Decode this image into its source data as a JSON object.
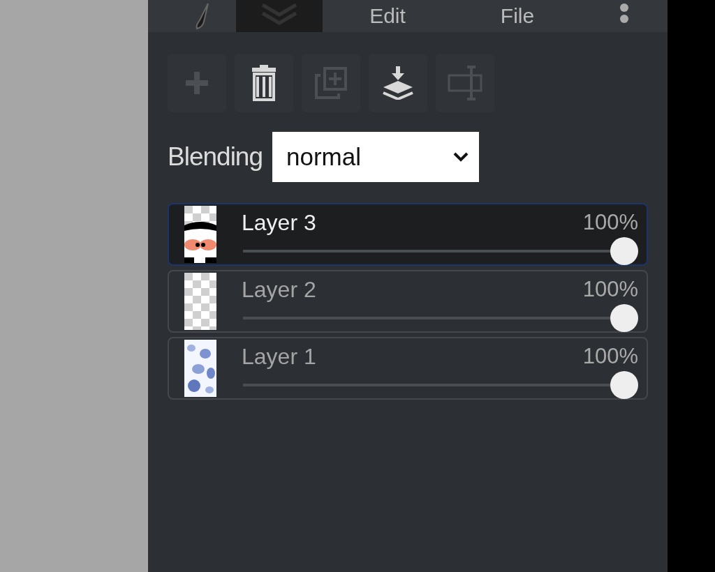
{
  "tabs": [
    {
      "kind": "brush",
      "selected": false
    },
    {
      "kind": "layers",
      "selected": true
    },
    {
      "kind": "text",
      "label": "Edit",
      "selected": false
    },
    {
      "kind": "text",
      "label": "File",
      "selected": false
    },
    {
      "kind": "more",
      "selected": false
    }
  ],
  "toolbar": [
    {
      "kind": "add",
      "disabled": true
    },
    {
      "kind": "delete",
      "disabled": false
    },
    {
      "kind": "duplicate",
      "disabled": true
    },
    {
      "kind": "merge",
      "disabled": false
    },
    {
      "kind": "resize",
      "disabled": true
    }
  ],
  "blending": {
    "label": "Blending",
    "value": "normal"
  },
  "layers": [
    {
      "name": "Layer 3",
      "opacity": "100%",
      "level": 1,
      "selected": true
    },
    {
      "name": "Layer 2",
      "opacity": "100%",
      "level": 1,
      "selected": false
    },
    {
      "name": "Layer 1",
      "opacity": "100%",
      "level": 1,
      "selected": false
    }
  ]
}
